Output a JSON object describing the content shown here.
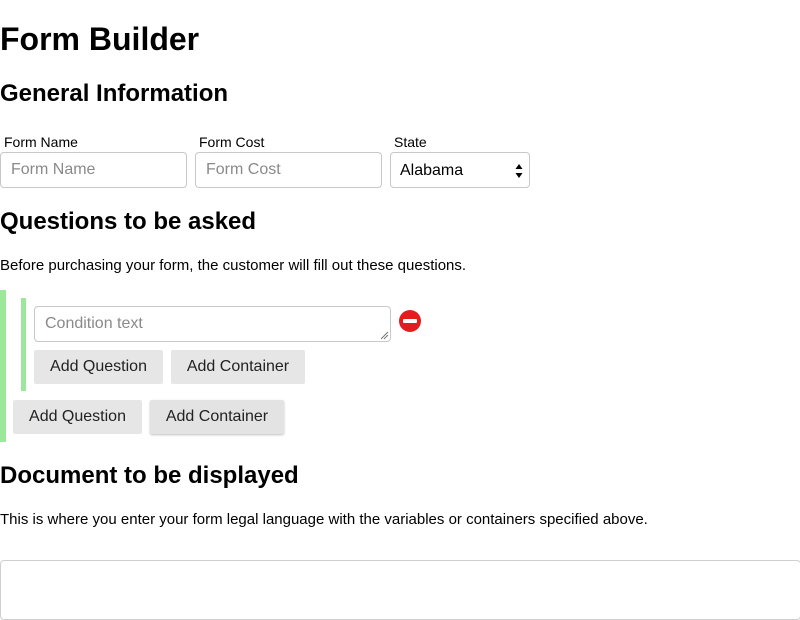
{
  "page": {
    "title": "Form Builder"
  },
  "general": {
    "heading": "General Information",
    "form_name_label": "Form Name",
    "form_name_placeholder": "Form Name",
    "form_name_value": "",
    "form_cost_label": "Form Cost",
    "form_cost_placeholder": "Form Cost",
    "form_cost_value": "",
    "state_label": "State",
    "state_value": "Alabama"
  },
  "questions": {
    "heading": "Questions to be asked",
    "description": "Before purchasing your form, the customer will fill out these questions.",
    "container": {
      "condition_placeholder": "Condition text",
      "condition_value": "",
      "add_question_label": "Add Question",
      "add_container_label": "Add Container"
    },
    "add_question_label": "Add Question",
    "add_container_label": "Add Container"
  },
  "document": {
    "heading": "Document to be displayed",
    "description": "This is where you enter your form legal language with the variables or containers specified above.",
    "value": ""
  },
  "icons": {
    "remove": "remove-circle-icon",
    "select_arrows": "up-down-arrows-icon",
    "resize_grip": "resize-grip-icon"
  },
  "colors": {
    "container_bar": "#9be89b",
    "remove_icon": "#e31c1c",
    "button_bg": "#e6e6e6"
  }
}
